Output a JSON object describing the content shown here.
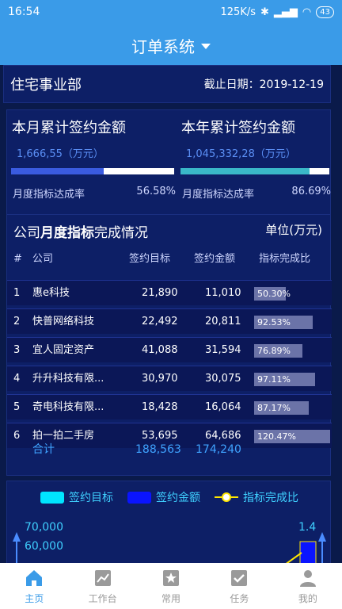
{
  "status_bar": {
    "time": "16:54",
    "speed": "125K/s",
    "battery": "43"
  },
  "header": {
    "title": "订单系统"
  },
  "dept": {
    "name": "住宅事业部",
    "deadline_label": "截止日期：",
    "deadline_date": "2019-12-19"
  },
  "summary": {
    "month": {
      "title": "本月累计签约金额",
      "amount": "1,666,55（万元）",
      "rate_label": "月度指标达成率",
      "rate": "56.58%",
      "rate_value": 0.5658
    },
    "year": {
      "title": "本年累计签约金额",
      "amount": "1,045,332,28（万元）",
      "rate_label": "月度指标达成率",
      "rate": "86.69%",
      "rate_value": 0.8669
    }
  },
  "table": {
    "title_prefix": "公司",
    "title_bold": "月度指标",
    "title_suffix": "完成情况",
    "unit": "单位(万元)",
    "headers": [
      "#",
      "公司",
      "签约目标",
      "签约金额",
      "指标完成比"
    ],
    "rows": [
      {
        "no": "1",
        "company": "惠e科技",
        "target": "21,890",
        "amount": "11,010",
        "ratio": "50.30%",
        "ratio_value": 50.3
      },
      {
        "no": "2",
        "company": "快普网络科技",
        "target": "22,492",
        "amount": "20,811",
        "ratio": "92.53%",
        "ratio_value": 92.53
      },
      {
        "no": "3",
        "company": "宜人固定资产",
        "target": "41,088",
        "amount": "31,594",
        "ratio": "76.89%",
        "ratio_value": 76.89
      },
      {
        "no": "4",
        "company": "升升科技有限...",
        "target": "30,970",
        "amount": "30,075",
        "ratio": "97.11%",
        "ratio_value": 97.11
      },
      {
        "no": "5",
        "company": "奇电科技有限...",
        "target": "18,428",
        "amount": "16,064",
        "ratio": "87.17%",
        "ratio_value": 87.17
      },
      {
        "no": "6",
        "company": "拍一拍二手房",
        "target": "53,695",
        "amount": "64,686",
        "ratio": "120.47%",
        "ratio_value": 120.47
      }
    ],
    "total": {
      "label": "合计",
      "target": "188,563",
      "amount": "174,240"
    }
  },
  "chart_data": {
    "type": "bar",
    "legend": [
      "签约目标",
      "签约金额",
      "指标完成比"
    ],
    "y_ticks_left": [
      "70,000",
      "60,000"
    ],
    "y_ticks_right": [
      "1.4"
    ],
    "colors": {
      "target": "#00e5ff",
      "amount": "#0a14ff",
      "ratio": "#ffe600"
    }
  },
  "tabs": [
    {
      "label": "主页",
      "icon": "home-icon",
      "active": true
    },
    {
      "label": "工作台",
      "icon": "chart-icon",
      "active": false
    },
    {
      "label": "常用",
      "icon": "star-icon",
      "active": false
    },
    {
      "label": "任务",
      "icon": "task-icon",
      "active": false
    },
    {
      "label": "我的",
      "icon": "user-icon",
      "active": false
    }
  ]
}
